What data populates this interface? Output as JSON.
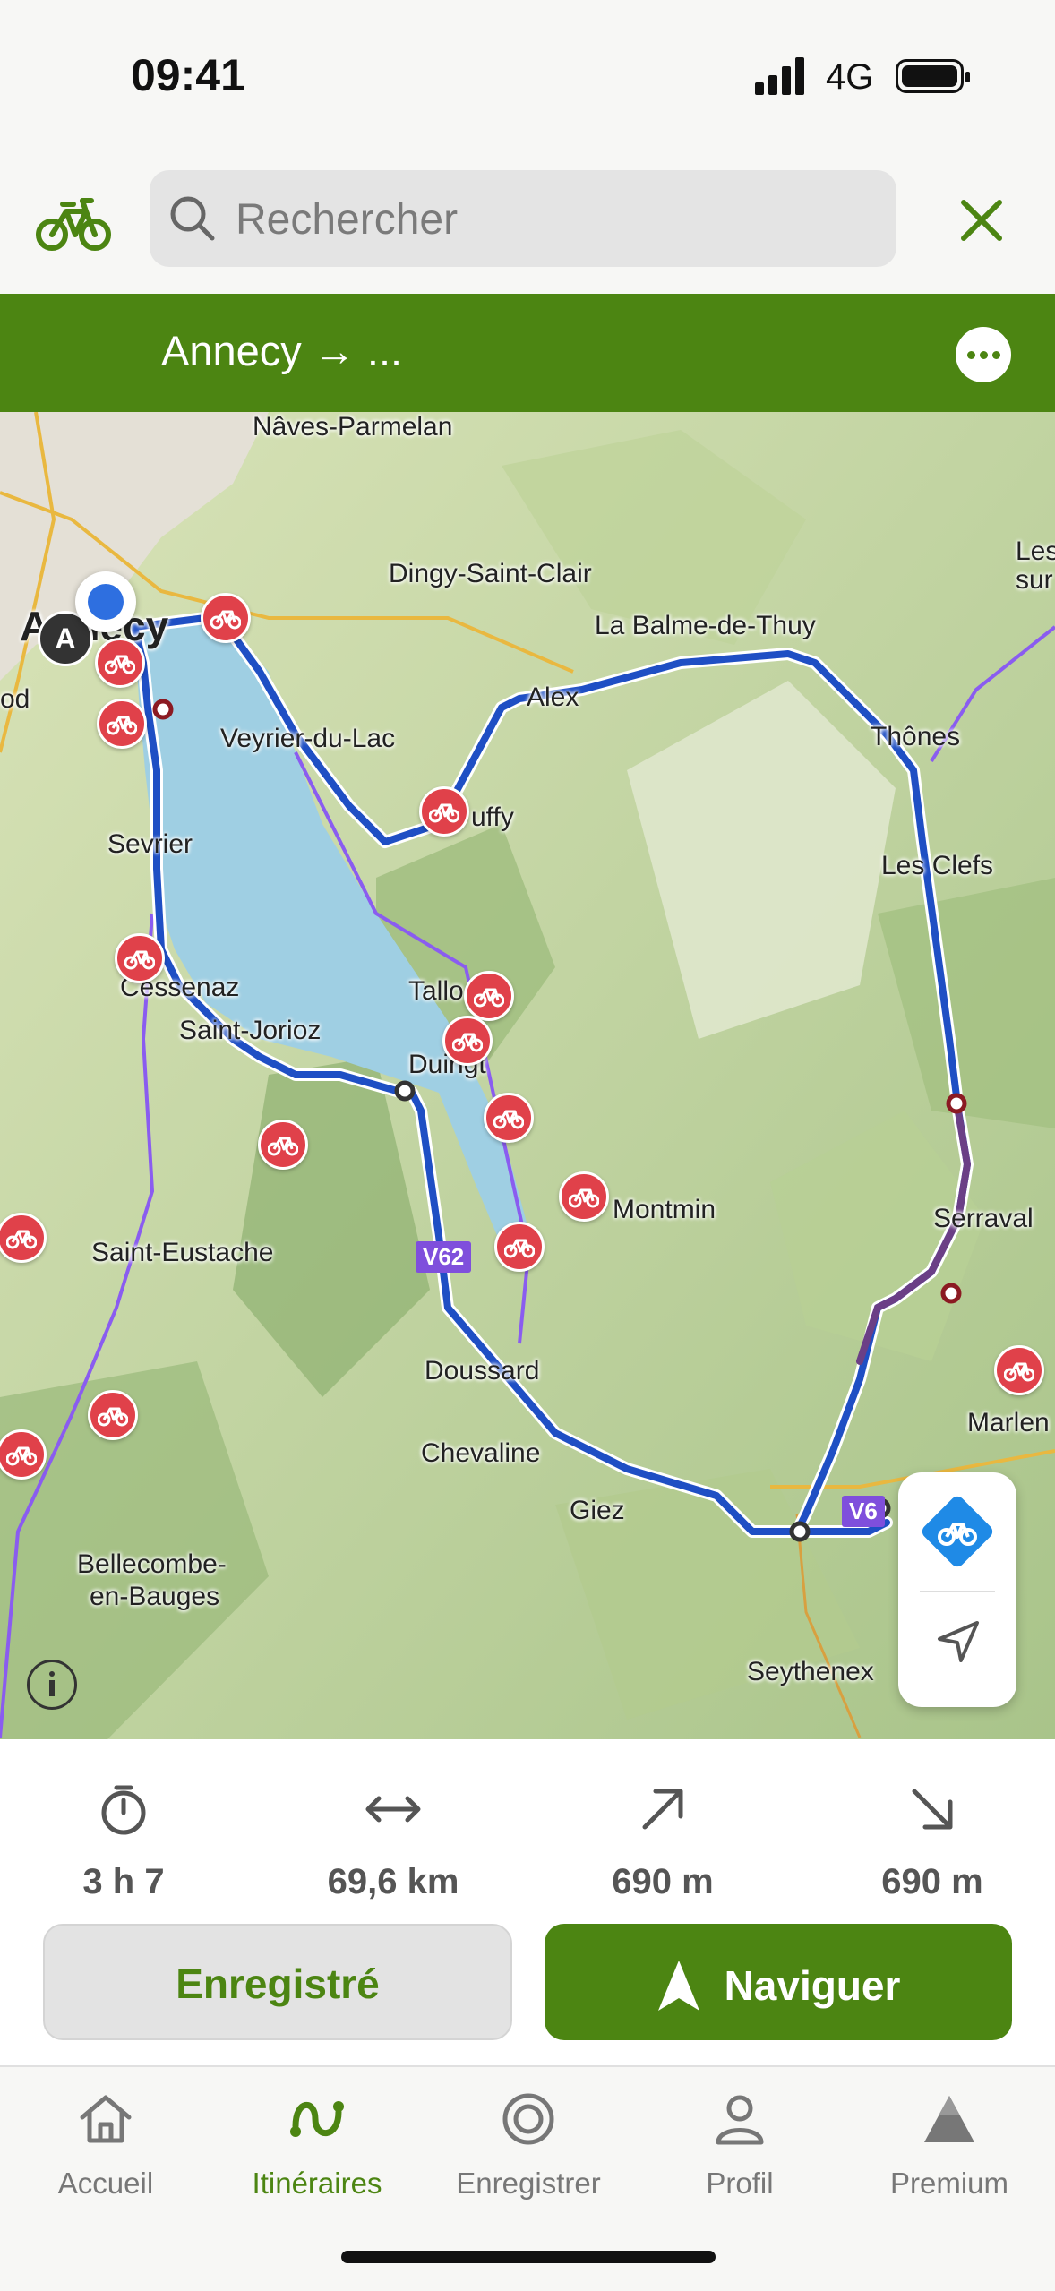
{
  "status_bar": {
    "time": "09:41",
    "network": "4G"
  },
  "search": {
    "placeholder": "Rechercher"
  },
  "route": {
    "title": "Annecy → ..."
  },
  "map": {
    "start_marker": "A",
    "road_shields": [
      "V62",
      "V6"
    ],
    "labels": [
      "Nâves-Parmelan",
      "Dingy-Saint-Clair",
      "Les sur",
      "Annecy",
      "od",
      "La Balme-de-Thuy",
      "Alex",
      "Veyrier-du-Lac",
      "Thônes",
      "uffy",
      "Sevrier",
      "Les Clefs",
      "Cessenaz",
      "Tallo",
      "Saint-Jorioz",
      "Duingt",
      "Serraval",
      "Montmin",
      "Saint-Eustache",
      "Doussard",
      "Marlen",
      "Chevaline",
      "Giez",
      "Bellecombe-",
      "en-Bauges",
      "Seythenex"
    ]
  },
  "stats": [
    {
      "icon": "stopwatch-icon",
      "value": "3 h 7"
    },
    {
      "icon": "distance-arrows-icon",
      "value": "69,6 km"
    },
    {
      "icon": "ascent-arrow-icon",
      "value": "690 m"
    },
    {
      "icon": "descent-arrow-icon",
      "value": "690 m"
    }
  ],
  "actions": {
    "saved": "Enregistré",
    "navigate": "Naviguer"
  },
  "tabs": [
    {
      "label": "Accueil",
      "icon": "home-icon"
    },
    {
      "label": "Itinéraires",
      "icon": "routes-icon"
    },
    {
      "label": "Enregistrer",
      "icon": "record-icon"
    },
    {
      "label": "Profil",
      "icon": "profile-icon"
    },
    {
      "label": "Premium",
      "icon": "premium-icon"
    }
  ],
  "colors": {
    "brand_green": "#4c8512",
    "route_blue": "#1f4fc4",
    "poi_red": "#e0414a",
    "shield_purple": "#7f4fdc"
  }
}
